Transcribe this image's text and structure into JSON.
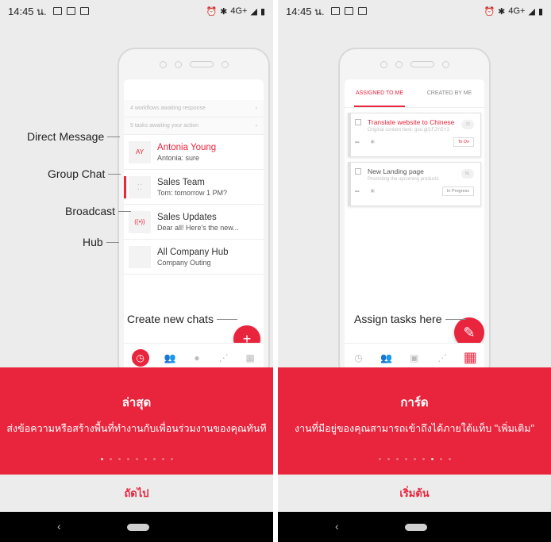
{
  "left": {
    "status": {
      "time": "14:45 น.",
      "network": "4G+"
    },
    "notices": [
      "4 workflows awaiting response",
      "5 tasks awaiting your action"
    ],
    "chats": [
      {
        "avatar": "AY",
        "name": "Antonia Young",
        "preview": "Antonia: sure",
        "unread": true
      },
      {
        "avatar": "",
        "name": "Sales Team",
        "preview": "Tom: tomorrow 1 PM?",
        "unread": false
      },
      {
        "avatar": "((•))",
        "name": "Sales Updates",
        "preview": "Dear all! Here's the new...",
        "unread": false
      },
      {
        "avatar": "",
        "name": "All Company Hub",
        "preview": "Company Outing",
        "unread": false
      }
    ],
    "callouts": {
      "direct": "Direct Message",
      "group": "Group Chat",
      "broadcast": "Broadcast",
      "hub": "Hub",
      "create": "Create new chats"
    },
    "fab_icon": "+",
    "panel": {
      "title": "ล่าสุด",
      "description": "ส่งข้อความหรือสร้างพื้นที่ทำงานกับเพื่อนร่วมงานของคุณทันที"
    },
    "button": "ถัดไป",
    "pager": {
      "current": 1,
      "total": 9
    }
  },
  "right": {
    "status": {
      "time": "14:45 น.",
      "network": "4G+"
    },
    "tabs": [
      "ASSIGNED TO ME",
      "CREATED BY ME"
    ],
    "tasks": [
      {
        "title": "Translate website to Chinese",
        "subtitle": "Original content here: goo.gl/1FJYGY2",
        "status": "To Do",
        "highlight": true
      },
      {
        "title": "New Landing page",
        "subtitle": "Promoting the upcoming products",
        "status": "In Progress",
        "highlight": false
      }
    ],
    "callout": "Assign tasks here",
    "panel": {
      "title": "การ์ด",
      "description": "งานที่มีอยู่ของคุณสามารถเข้าถึงได้ภายใต้แท็บ \"เพิ่มเติม\""
    },
    "button": "เริ่มต้น",
    "pager": {
      "current": 7,
      "total": 9
    }
  },
  "colors": {
    "accent": "#e8253d",
    "background": "#ececec"
  }
}
